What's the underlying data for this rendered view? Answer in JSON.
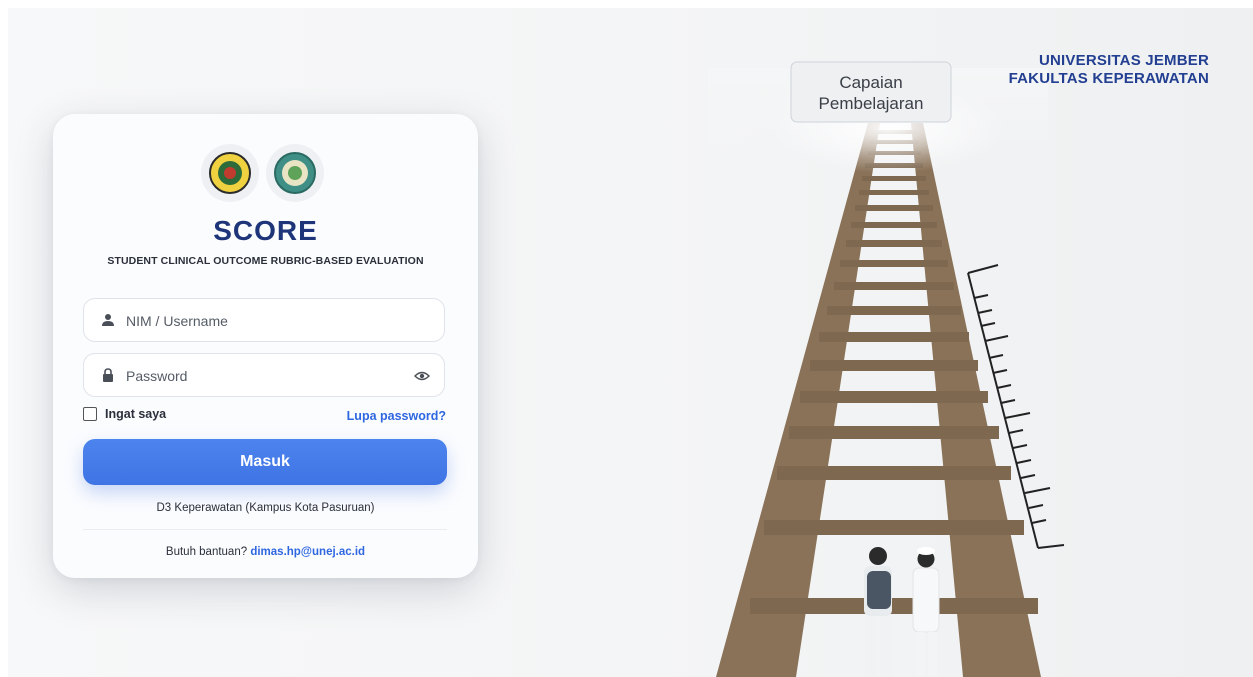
{
  "header": {
    "university": "UNIVERSITAS JEMBER",
    "faculty": "FAKULTAS KEPERAWATAN"
  },
  "hero": {
    "sign_line1": "Capaian",
    "sign_line2": "Pembelajaran"
  },
  "login": {
    "logos": [
      "university-logo",
      "faculty-logo"
    ],
    "title": "SCORE",
    "subtitle": "STUDENT CLINICAL OUTCOME RUBRIC-BASED EVALUATION",
    "username_placeholder": "NIM / Username",
    "password_placeholder": "Password",
    "remember_label": "Ingat saya",
    "forgot_label": "Lupa password?",
    "submit_label": "Masuk",
    "campus": "D3 Keperawatan (Kampus Kota Pasuruan)",
    "help_text": "Butuh bantuan?",
    "help_email": "dimas.hp@unej.ac.id"
  },
  "colors": {
    "brand_navy": "#1f3579",
    "accent_blue": "#3f74e4",
    "link_blue": "#2f67e0"
  }
}
